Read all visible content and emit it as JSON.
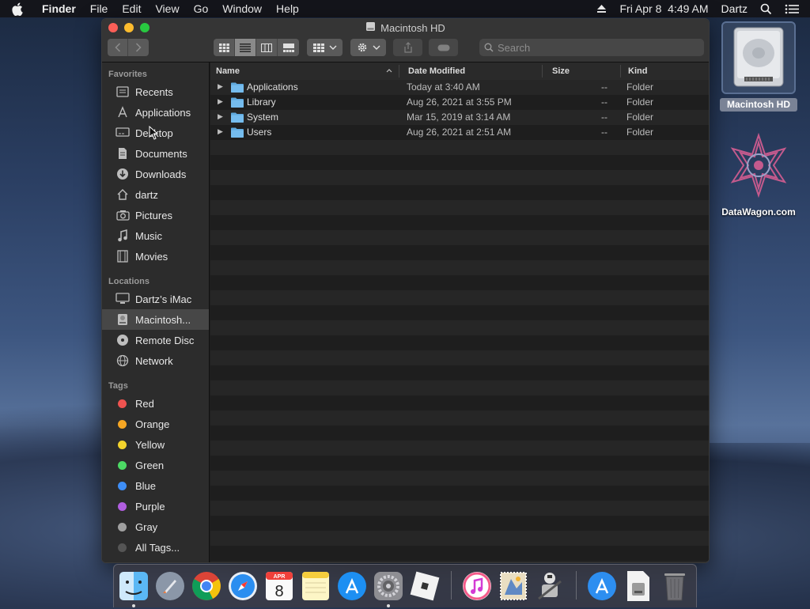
{
  "menubar": {
    "app_name": "Finder",
    "menus": [
      "File",
      "Edit",
      "View",
      "Go",
      "Window",
      "Help"
    ],
    "datetime": "Fri Apr 8  4:49 AM",
    "user": "Dartz"
  },
  "window": {
    "title": "Macintosh HD",
    "search_placeholder": "Search"
  },
  "sidebar": {
    "favorites_header": "Favorites",
    "favorites": [
      {
        "label": "Recents",
        "icon": "clock-icon"
      },
      {
        "label": "Applications",
        "icon": "applications-icon"
      },
      {
        "label": "Desktop",
        "icon": "desktop-icon"
      },
      {
        "label": "Documents",
        "icon": "document-icon"
      },
      {
        "label": "Downloads",
        "icon": "download-icon"
      },
      {
        "label": "dartz",
        "icon": "home-icon"
      },
      {
        "label": "Pictures",
        "icon": "camera-icon"
      },
      {
        "label": "Music",
        "icon": "music-note-icon"
      },
      {
        "label": "Movies",
        "icon": "film-icon"
      }
    ],
    "locations_header": "Locations",
    "locations": [
      {
        "label": "Dartz’s iMac",
        "icon": "imac-icon"
      },
      {
        "label": "Macintosh...",
        "icon": "hard-drive-icon",
        "selected": true
      },
      {
        "label": "Remote Disc",
        "icon": "disc-icon"
      },
      {
        "label": "Network",
        "icon": "globe-icon"
      }
    ],
    "tags_header": "Tags",
    "tags": [
      {
        "label": "Red",
        "color": "#ef5350"
      },
      {
        "label": "Orange",
        "color": "#f5a623"
      },
      {
        "label": "Yellow",
        "color": "#f3d32c"
      },
      {
        "label": "Green",
        "color": "#4cd964"
      },
      {
        "label": "Blue",
        "color": "#3e8ef7"
      },
      {
        "label": "Purple",
        "color": "#b15ee0"
      },
      {
        "label": "Gray",
        "color": "#a0a0a0"
      },
      {
        "label": "All Tags...",
        "color": "#555555"
      }
    ]
  },
  "columns": {
    "name": "Name",
    "date": "Date Modified",
    "size": "Size",
    "kind": "Kind"
  },
  "files": [
    {
      "name": "Applications",
      "date": "Today at 3:40 AM",
      "size": "--",
      "kind": "Folder"
    },
    {
      "name": "Library",
      "date": "Aug 26, 2021 at 3:55 PM",
      "size": "--",
      "kind": "Folder"
    },
    {
      "name": "System",
      "date": "Mar 15, 2019 at 3:14 AM",
      "size": "--",
      "kind": "Folder"
    },
    {
      "name": "Users",
      "date": "Aug 26, 2021 at 2:51 AM",
      "size": "--",
      "kind": "Folder"
    }
  ],
  "desktop": {
    "hd_label": "Macintosh HD",
    "datawagon_label": "DataWagon.com"
  },
  "dock": {
    "calendar_month": "APR",
    "calendar_day": "8"
  }
}
